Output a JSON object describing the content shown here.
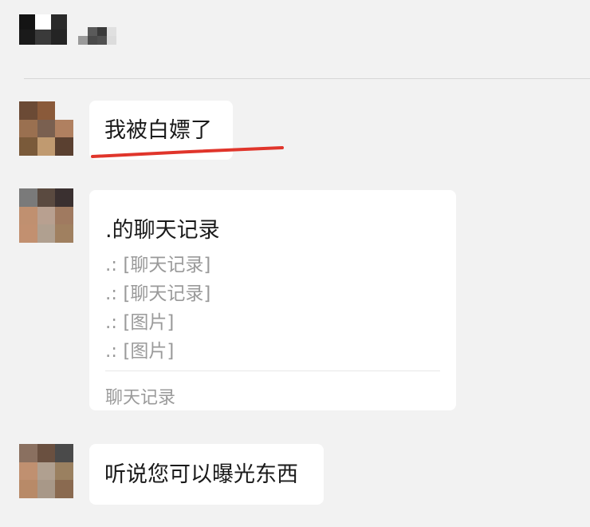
{
  "header": {
    "title": "",
    "subtitle": ""
  },
  "messages": [
    {
      "text": "我被白嫖了"
    },
    {
      "forward": {
        "title": ".的聊天记录",
        "lines": [
          ".: [聊天记录]",
          ".: [聊天记录]",
          ".: [图片]",
          ".: [图片]"
        ],
        "footer": "聊天记录"
      }
    },
    {
      "text": "听说您可以曝光东西"
    }
  ],
  "colors": {
    "background": "#f2f2f2",
    "bubble": "#ffffff",
    "annotation_underline": "#e0352b",
    "muted_text": "#9a9a9a"
  },
  "icons": {
    "avatar": "pixelated-avatar",
    "header": "pixelated-contact-name"
  }
}
